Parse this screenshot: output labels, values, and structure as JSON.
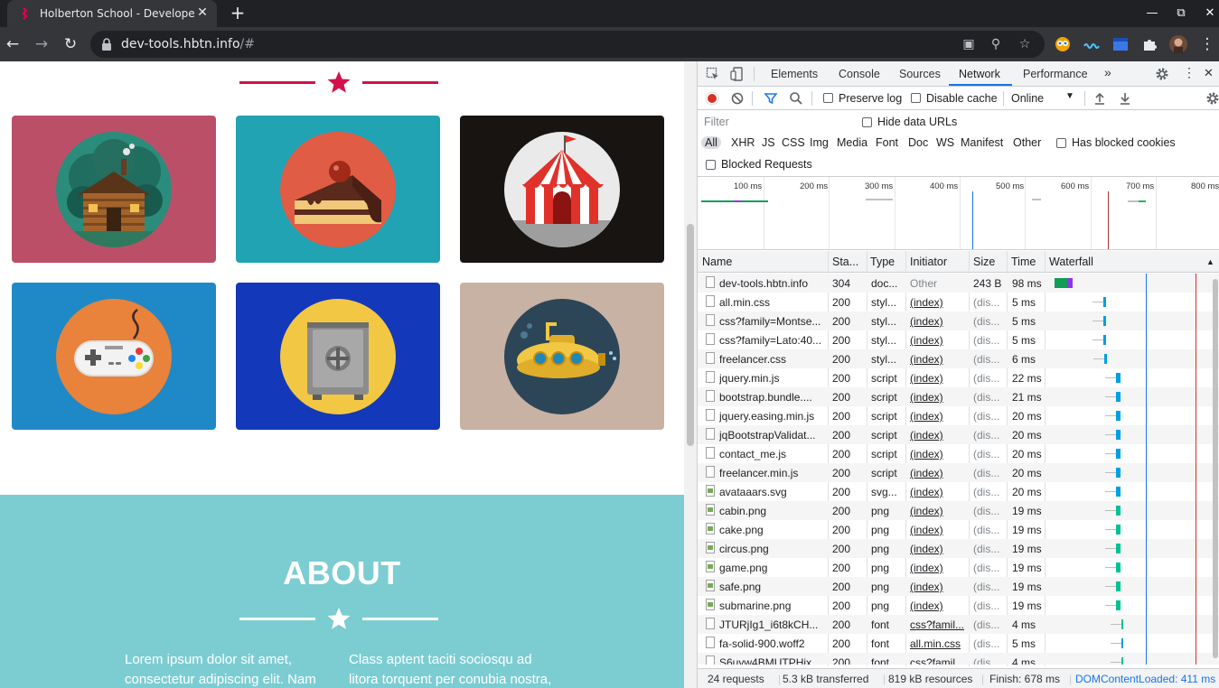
{
  "browser": {
    "tab_title": "Holberton School - Developer",
    "url_host": "dev-tools.hbtn.info",
    "url_path": "/#"
  },
  "page": {
    "about_title": "ABOUT",
    "about_col1": "Lorem ipsum dolor sit amet, consectetur adipiscing elit. Nam",
    "about_col2": "Class aptent taciti sociosqu ad litora torquent per conubia nostra,",
    "accent_color": "#d4104b",
    "portfolio": [
      {
        "name": "cabin",
        "bg": "#bc4f68"
      },
      {
        "name": "cake",
        "bg": "#21a3b3"
      },
      {
        "name": "circus",
        "bg": "#171412"
      },
      {
        "name": "game",
        "bg": "#1f89c7"
      },
      {
        "name": "safe",
        "bg": "#1338b9"
      },
      {
        "name": "submarine",
        "bg": "#c8b2a4"
      }
    ]
  },
  "devtools": {
    "tabs": [
      "Elements",
      "Console",
      "Sources",
      "Network",
      "Performance"
    ],
    "active_tab": "Network",
    "toolbar": {
      "preserve_log": "Preserve log",
      "disable_cache": "Disable cache",
      "throttle": "Online"
    },
    "filter": {
      "placeholder": "Filter",
      "hide_data_urls": "Hide data URLs",
      "types": [
        "All",
        "XHR",
        "JS",
        "CSS",
        "Img",
        "Media",
        "Font",
        "Doc",
        "WS",
        "Manifest",
        "Other"
      ],
      "has_blocked_cookies": "Has blocked cookies",
      "blocked_requests": "Blocked Requests"
    },
    "overview_ticks": [
      "100 ms",
      "200 ms",
      "300 ms",
      "400 ms",
      "500 ms",
      "600 ms",
      "700 ms",
      "800 ms"
    ],
    "columns": [
      "Name",
      "Sta...",
      "Type",
      "Initiator",
      "Size",
      "Time",
      "Waterfall"
    ],
    "requests": [
      {
        "name": "dev-tools.hbtn.info",
        "status": "304",
        "type": "doc...",
        "initiator": "Other",
        "size": "243 B",
        "time": "98 ms",
        "icon": "doc"
      },
      {
        "name": "all.min.css",
        "status": "200",
        "type": "styl...",
        "initiator": "(index)",
        "size": "(dis...",
        "time": "5 ms",
        "icon": "doc"
      },
      {
        "name": "css?family=Montse...",
        "status": "200",
        "type": "styl...",
        "initiator": "(index)",
        "size": "(dis...",
        "time": "5 ms",
        "icon": "doc"
      },
      {
        "name": "css?family=Lato:40...",
        "status": "200",
        "type": "styl...",
        "initiator": "(index)",
        "size": "(dis...",
        "time": "5 ms",
        "icon": "doc"
      },
      {
        "name": "freelancer.css",
        "status": "200",
        "type": "styl...",
        "initiator": "(index)",
        "size": "(dis...",
        "time": "6 ms",
        "icon": "doc"
      },
      {
        "name": "jquery.min.js",
        "status": "200",
        "type": "script",
        "initiator": "(index)",
        "size": "(dis...",
        "time": "22 ms",
        "icon": "doc"
      },
      {
        "name": "bootstrap.bundle....",
        "status": "200",
        "type": "script",
        "initiator": "(index)",
        "size": "(dis...",
        "time": "21 ms",
        "icon": "doc"
      },
      {
        "name": "jquery.easing.min.js",
        "status": "200",
        "type": "script",
        "initiator": "(index)",
        "size": "(dis...",
        "time": "20 ms",
        "icon": "doc"
      },
      {
        "name": "jqBootstrapValidat...",
        "status": "200",
        "type": "script",
        "initiator": "(index)",
        "size": "(dis...",
        "time": "20 ms",
        "icon": "doc"
      },
      {
        "name": "contact_me.js",
        "status": "200",
        "type": "script",
        "initiator": "(index)",
        "size": "(dis...",
        "time": "20 ms",
        "icon": "doc"
      },
      {
        "name": "freelancer.min.js",
        "status": "200",
        "type": "script",
        "initiator": "(index)",
        "size": "(dis...",
        "time": "20 ms",
        "icon": "doc"
      },
      {
        "name": "avataaars.svg",
        "status": "200",
        "type": "svg...",
        "initiator": "(index)",
        "size": "(dis...",
        "time": "20 ms",
        "icon": "img"
      },
      {
        "name": "cabin.png",
        "status": "200",
        "type": "png",
        "initiator": "(index)",
        "size": "(dis...",
        "time": "19 ms",
        "icon": "img"
      },
      {
        "name": "cake.png",
        "status": "200",
        "type": "png",
        "initiator": "(index)",
        "size": "(dis...",
        "time": "19 ms",
        "icon": "img"
      },
      {
        "name": "circus.png",
        "status": "200",
        "type": "png",
        "initiator": "(index)",
        "size": "(dis...",
        "time": "19 ms",
        "icon": "img"
      },
      {
        "name": "game.png",
        "status": "200",
        "type": "png",
        "initiator": "(index)",
        "size": "(dis...",
        "time": "19 ms",
        "icon": "img"
      },
      {
        "name": "safe.png",
        "status": "200",
        "type": "png",
        "initiator": "(index)",
        "size": "(dis...",
        "time": "19 ms",
        "icon": "img"
      },
      {
        "name": "submarine.png",
        "status": "200",
        "type": "png",
        "initiator": "(index)",
        "size": "(dis...",
        "time": "19 ms",
        "icon": "img"
      },
      {
        "name": "JTURjIg1_i6t8kCH...",
        "status": "200",
        "type": "font",
        "initiator": "css?famil...",
        "size": "(dis...",
        "time": "4 ms",
        "icon": "doc"
      },
      {
        "name": "fa-solid-900.woff2",
        "status": "200",
        "type": "font",
        "initiator": "all.min.css",
        "size": "(dis...",
        "time": "5 ms",
        "icon": "doc"
      },
      {
        "name": "S6uyw4BMUTPHjx",
        "status": "200",
        "type": "font",
        "initiator": "css?famil",
        "size": "(dis...",
        "time": "4 ms",
        "icon": "doc"
      }
    ],
    "status_bar": {
      "requests": "24 requests",
      "transferred": "5.3 kB transferred",
      "resources": "819 kB resources",
      "finish": "Finish: 678 ms",
      "dcl": "DOMContentLoaded: 411 ms"
    }
  }
}
